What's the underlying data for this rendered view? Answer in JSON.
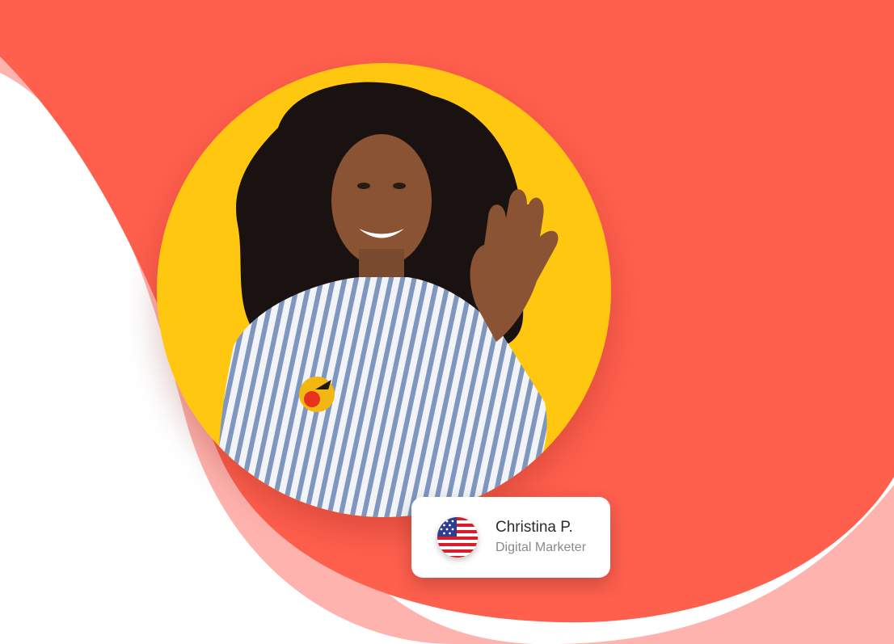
{
  "profile": {
    "name": "Christina P.",
    "role": "Digital Marketer",
    "flag_icon": "us-flag-icon"
  },
  "colors": {
    "background": "#ffffff",
    "coral": "#ff5f4d",
    "pink_wave": "#ffb3ae",
    "portrait_circle": "#ffc710",
    "card": "#ffffff"
  }
}
